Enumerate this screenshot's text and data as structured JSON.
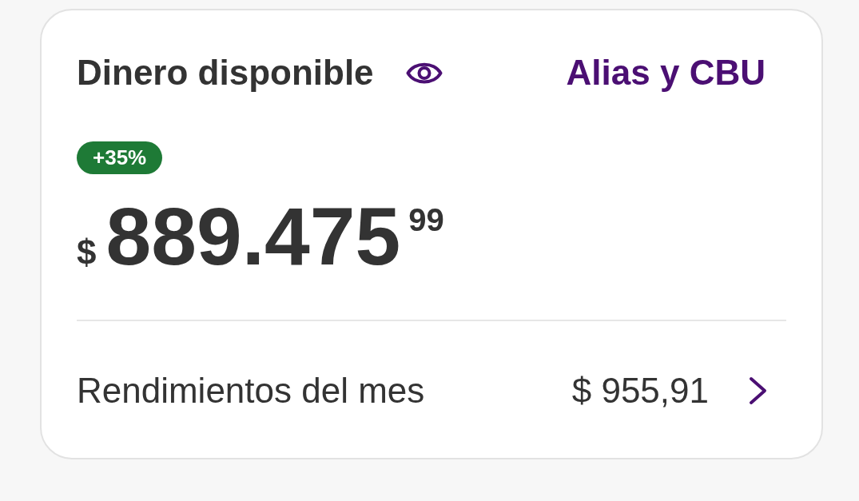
{
  "card": {
    "title": "Dinero disponible",
    "link": "Alias y CBU",
    "badge": "+35%",
    "balance": {
      "currency": "$",
      "amount": "889.475",
      "cents": "99"
    },
    "earnings": {
      "label": "Rendimientos del mes",
      "value": "$ 955,91"
    }
  }
}
